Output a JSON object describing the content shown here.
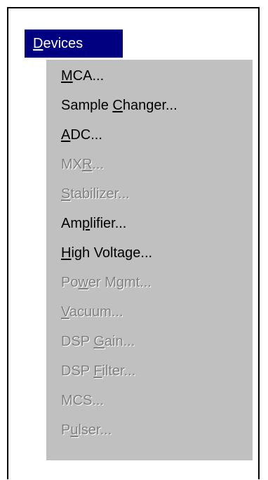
{
  "menu": {
    "title": {
      "prefix": "",
      "mnemonic": "D",
      "suffix": "evices"
    },
    "items": [
      {
        "prefix": "",
        "mnemonic": "M",
        "suffix": "CA...",
        "enabled": true
      },
      {
        "prefix": "Sample ",
        "mnemonic": "C",
        "suffix": "hanger...",
        "enabled": true
      },
      {
        "prefix": "",
        "mnemonic": "A",
        "suffix": "DC...",
        "enabled": true
      },
      {
        "prefix": "MX",
        "mnemonic": "R",
        "suffix": "...",
        "enabled": false
      },
      {
        "prefix": "",
        "mnemonic": "S",
        "suffix": "tabilizer...",
        "enabled": false
      },
      {
        "prefix": "Am",
        "mnemonic": "p",
        "suffix": "lifier...",
        "enabled": true
      },
      {
        "prefix": "",
        "mnemonic": "H",
        "suffix": "igh Voltage...",
        "enabled": true
      },
      {
        "prefix": "Po",
        "mnemonic": "w",
        "suffix": "er Mgmt...",
        "enabled": false
      },
      {
        "prefix": "",
        "mnemonic": "V",
        "suffix": "acuum...",
        "enabled": false
      },
      {
        "prefix": "DSP ",
        "mnemonic": "G",
        "suffix": "ain...",
        "enabled": false
      },
      {
        "prefix": "DSP ",
        "mnemonic": "F",
        "suffix": "ilter...",
        "enabled": false
      },
      {
        "prefix": "MCS...",
        "mnemonic": "",
        "suffix": "",
        "enabled": false
      },
      {
        "prefix": "P",
        "mnemonic": "u",
        "suffix": "lser...",
        "enabled": false
      }
    ]
  },
  "colors": {
    "menu_bar_highlight": "#000080",
    "menu_background": "#c0c0c0",
    "enabled_text": "#000000",
    "disabled_text": "#808080",
    "disabled_shadow": "#ffffff"
  }
}
